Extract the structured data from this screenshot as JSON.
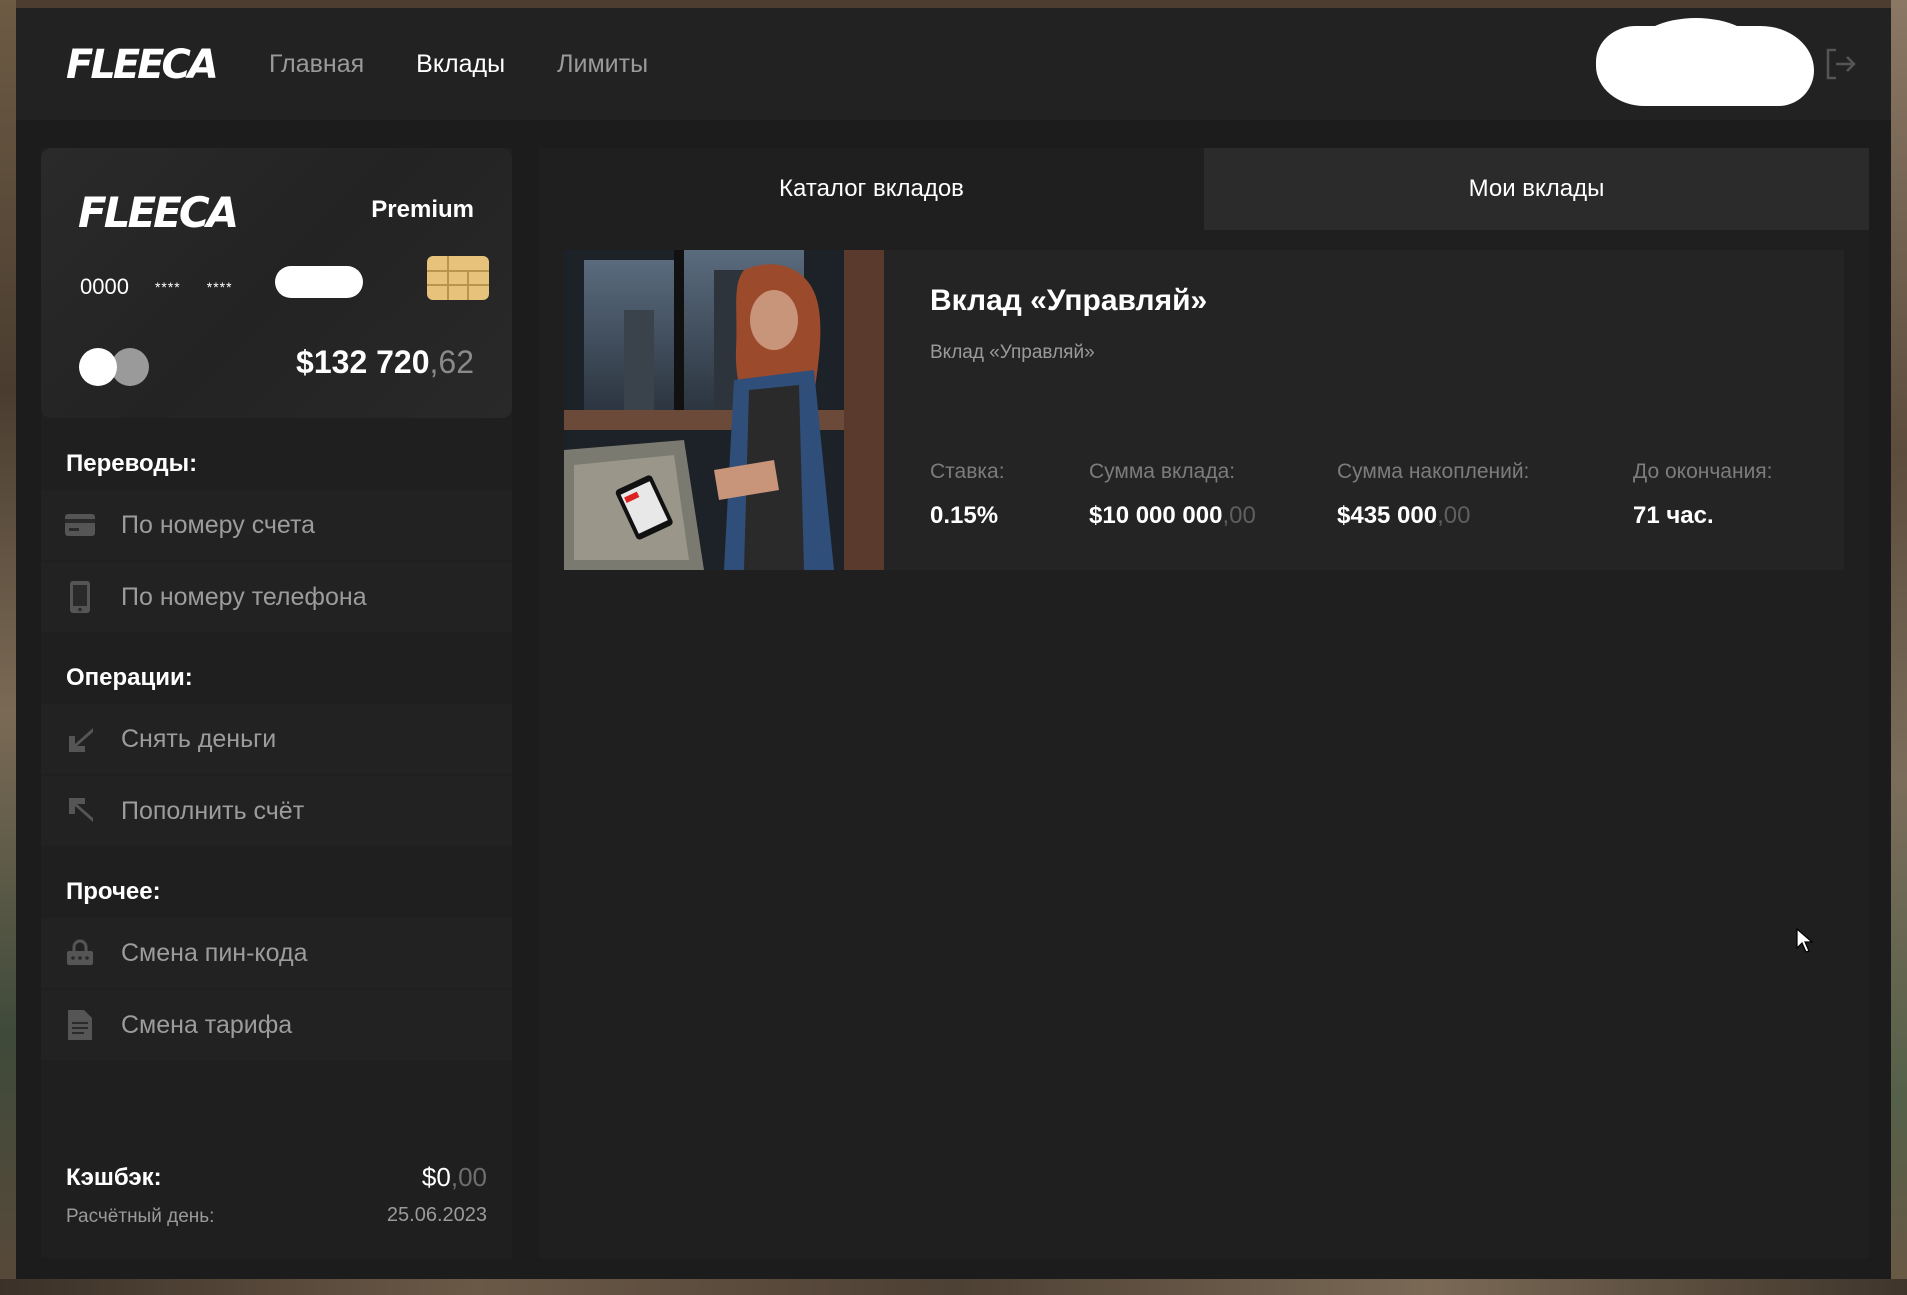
{
  "header": {
    "logo": "FLEECA",
    "nav": [
      {
        "label": "Главная",
        "active": false
      },
      {
        "label": "Вклады",
        "active": true
      },
      {
        "label": "Лимиты",
        "active": false
      }
    ]
  },
  "card": {
    "logo": "FLEECA",
    "tier": "Premium",
    "number_start": "0000",
    "masked_group_1": "****",
    "masked_group_2": "****",
    "balance_main": "$132 720",
    "balance_cents": ",62"
  },
  "sidebar": {
    "transfers_title": "Переводы:",
    "transfers": [
      {
        "label": "По номеру счета",
        "icon": "card-icon"
      },
      {
        "label": "По номеру телефона",
        "icon": "phone-icon"
      }
    ],
    "operations_title": "Операции:",
    "operations": [
      {
        "label": "Снять деньги",
        "icon": "arrow-down-left-icon"
      },
      {
        "label": "Пополнить счёт",
        "icon": "arrow-up-left-icon"
      }
    ],
    "other_title": "Прочее:",
    "other": [
      {
        "label": "Смена пин-кода",
        "icon": "lock-icon"
      },
      {
        "label": "Смена тарифа",
        "icon": "document-icon"
      }
    ],
    "cashback_label": "Кэшбэк:",
    "cashback_main": "$0",
    "cashback_cents": ",00",
    "payday_label": "Расчётный день:",
    "payday_value": "25.06.2023"
  },
  "tabs": [
    {
      "label": "Каталог вкладов",
      "active": true
    },
    {
      "label": "Мои вклады",
      "active": false
    }
  ],
  "deposit": {
    "title": "Вклад «Управляй»",
    "subtitle": "Вклад «Управляй»",
    "stats": [
      {
        "label": "Ставка:",
        "value": "0.15%",
        "cents": ""
      },
      {
        "label": "Сумма вклада:",
        "value": "$10 000 000",
        "cents": ",00"
      },
      {
        "label": "Сумма накоплений:",
        "value": "$435 000",
        "cents": ",00"
      },
      {
        "label": "До окончания:",
        "value": "71 час.",
        "cents": ""
      }
    ]
  },
  "colors": {
    "background": "#1c1c1c",
    "panel": "#222222",
    "chip": "#e7c27a",
    "muted_text": "#9a9a9a"
  }
}
